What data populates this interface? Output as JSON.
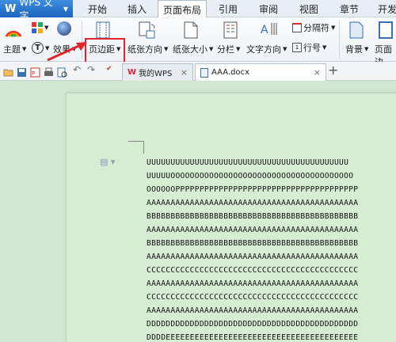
{
  "app": {
    "logo": "W",
    "name": "WPS 文字"
  },
  "menu": {
    "tabs": [
      "开始",
      "插入",
      "页面布局",
      "引用",
      "审阅",
      "视图",
      "章节",
      "开发"
    ],
    "active": "页面布局"
  },
  "ribbon": {
    "theme": "主题",
    "effect": "效果",
    "margins": "页边距",
    "orientation": "纸张方向",
    "size": "纸张大小",
    "columns": "分栏",
    "text_direction": "文字方向",
    "breaks": "分隔符",
    "line_numbers": "行号",
    "background": "背景",
    "page_border": "页面边"
  },
  "doc_tabs": [
    {
      "label": "我的WPS"
    },
    {
      "label": "AAA.docx"
    }
  ],
  "new_tab": "+",
  "document": {
    "lines": [
      "UUUUUUUUUUUUUUUUUUUUUUUUUUUUUUUUUUUUUUUUUU",
      "UUUUUOOOOOOOOOOOOOOOOOOOOOOOOOOOOOOOOOOOOOO",
      "OOOOOOPPPPPPPPPPPPPPPPPPPPPPPPPPPPPPPPPPPPPP",
      "AAAAAAAAAAAAAAAAAAAAAAAAAAAAAAAAAAAAAAAAAAAA",
      "BBBBBBBBBBBBBBBBBBBBBBBBBBBBBBBBBBBBBBBBBBBB",
      "AAAAAAAAAAAAAAAAAAAAAAAAAAAAAAAAAAAAAAAAAAAA",
      "BBBBBBBBBBBBBBBBBBBBBBBBBBBBBBBBBBBBBBBBBBBB",
      "AAAAAAAAAAAAAAAAAAAAAAAAAAAAAAAAAAAAAAAAAAAA",
      "CCCCCCCCCCCCCCCCCCCCCCCCCCCCCCCCCCCCCCCCCCCC",
      "AAAAAAAAAAAAAAAAAAAAAAAAAAAAAAAAAAAAAAAAAAAA",
      "CCCCCCCCCCCCCCCCCCCCCCCCCCCCCCCCCCCCCCCCCCCC",
      "AAAAAAAAAAAAAAAAAAAAAAAAAAAAAAAAAAAAAAAAAAAA",
      "DDDDDDDDDDDDDDDDDDDDDDDDDDDDDDDDDDDDDDDDDDDD",
      "DDDDEEEEEEEEEEEEEEEEEEEEEEEEEEEEEEEEEEEEEEEE"
    ]
  },
  "colors": {
    "accent": "#1c63be",
    "highlight": "#e0262b",
    "page": "#d6ecd3"
  }
}
